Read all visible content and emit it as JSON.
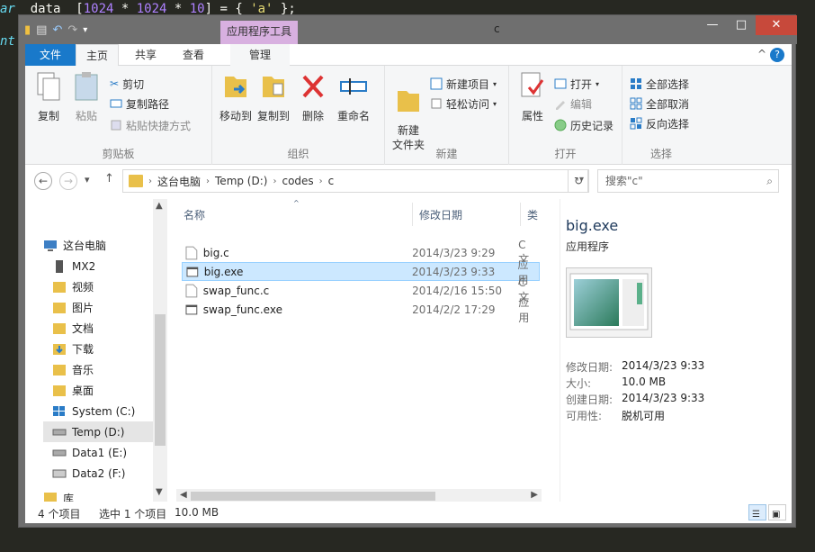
{
  "editor": {
    "line1_kw": "ar",
    "line1_text": "  data  [",
    "line1_n1": "1024",
    "line1_op1": " * ",
    "line1_n2": "1024",
    "line1_op2": " * ",
    "line1_n3": "10",
    "line1_mid": "] = { ",
    "line1_str": "'a'",
    "line1_end": " };",
    "line2_kw": "nt"
  },
  "window": {
    "title": "c",
    "contextual_tab": "应用程序工具",
    "minimize": "—",
    "maximize": "□",
    "close": "✕"
  },
  "tabs": {
    "file": "文件",
    "home": "主页",
    "share": "共享",
    "view": "查看",
    "manage": "管理",
    "help": "?",
    "collapse": "^"
  },
  "ribbon": {
    "clipboard": {
      "label": "剪贴板",
      "copy": "复制",
      "paste": "粘贴",
      "cut": "剪切",
      "copy_path": "复制路径",
      "paste_shortcut": "粘贴快捷方式"
    },
    "organize": {
      "label": "组织",
      "move_to": "移动到",
      "copy_to": "复制到",
      "delete": "删除",
      "rename": "重命名"
    },
    "new": {
      "label": "新建",
      "new_folder": "新建\n文件夹",
      "new_item": "新建项目",
      "easy_access": "轻松访问"
    },
    "open": {
      "label": "打开",
      "properties": "属性",
      "open": "打开",
      "edit": "编辑",
      "history": "历史记录"
    },
    "select": {
      "label": "选择",
      "select_all": "全部选择",
      "select_none": "全部取消",
      "invert": "反向选择"
    }
  },
  "address": {
    "segments": [
      "这台电脑",
      "Temp (D:)",
      "codes",
      "c"
    ],
    "search_placeholder": "搜索\"c\""
  },
  "nav": {
    "items": [
      {
        "label": "这台电脑"
      },
      {
        "label": "MX2"
      },
      {
        "label": "视频"
      },
      {
        "label": "图片"
      },
      {
        "label": "文档"
      },
      {
        "label": "下载"
      },
      {
        "label": "音乐"
      },
      {
        "label": "桌面"
      },
      {
        "label": "System (C:)"
      },
      {
        "label": "Temp (D:)"
      },
      {
        "label": "Data1 (E:)"
      },
      {
        "label": "Data2 (F:)"
      },
      {
        "label": "库"
      }
    ]
  },
  "files": {
    "columns": {
      "name": "名称",
      "date": "修改日期",
      "type": "类型"
    },
    "rows": [
      {
        "name": "big.c",
        "date": "2014/3/23 9:29",
        "type": "C 文"
      },
      {
        "name": "big.exe",
        "date": "2014/3/23 9:33",
        "type": "应用"
      },
      {
        "name": "swap_func.c",
        "date": "2014/2/16 15:50",
        "type": "C 文"
      },
      {
        "name": "swap_func.exe",
        "date": "2014/2/2 17:29",
        "type": "应用"
      }
    ]
  },
  "preview": {
    "title": "big.exe",
    "type": "应用程序",
    "props": [
      {
        "k": "修改日期:",
        "v": "2014/3/23 9:33"
      },
      {
        "k": "大小:",
        "v": "10.0 MB"
      },
      {
        "k": "创建日期:",
        "v": "2014/3/23 9:33"
      },
      {
        "k": "可用性:",
        "v": "脱机可用"
      }
    ]
  },
  "status": {
    "count": "4 个项目",
    "selected": "选中 1 个项目",
    "size": "10.0 MB"
  },
  "colors": {
    "accent": "#1979ca",
    "selection": "#cce8ff",
    "context_tab": "#d8b0e0"
  }
}
